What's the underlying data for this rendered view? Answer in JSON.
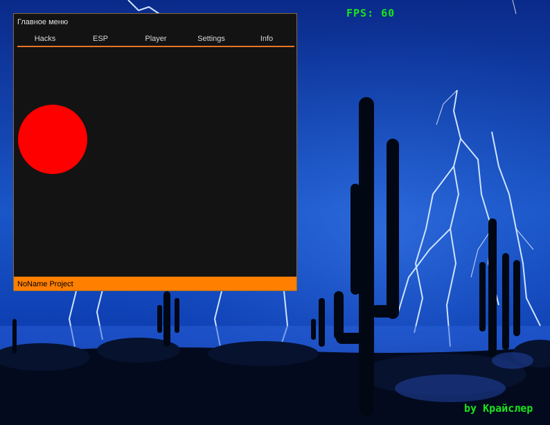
{
  "overlay": {
    "fps_text": "FPS: 60",
    "credit_text": "by Крайслер",
    "text_color": "#19e619"
  },
  "menu": {
    "title": "Главное меню",
    "accent_color": "#ff7f00",
    "tabs": [
      {
        "label": "Hacks"
      },
      {
        "label": "ESP"
      },
      {
        "label": "Player"
      },
      {
        "label": "Settings"
      },
      {
        "label": "Info"
      }
    ],
    "footer": "NoName Project"
  },
  "wallpaper": {
    "description_icon": "desert-lightning-wallpaper"
  }
}
